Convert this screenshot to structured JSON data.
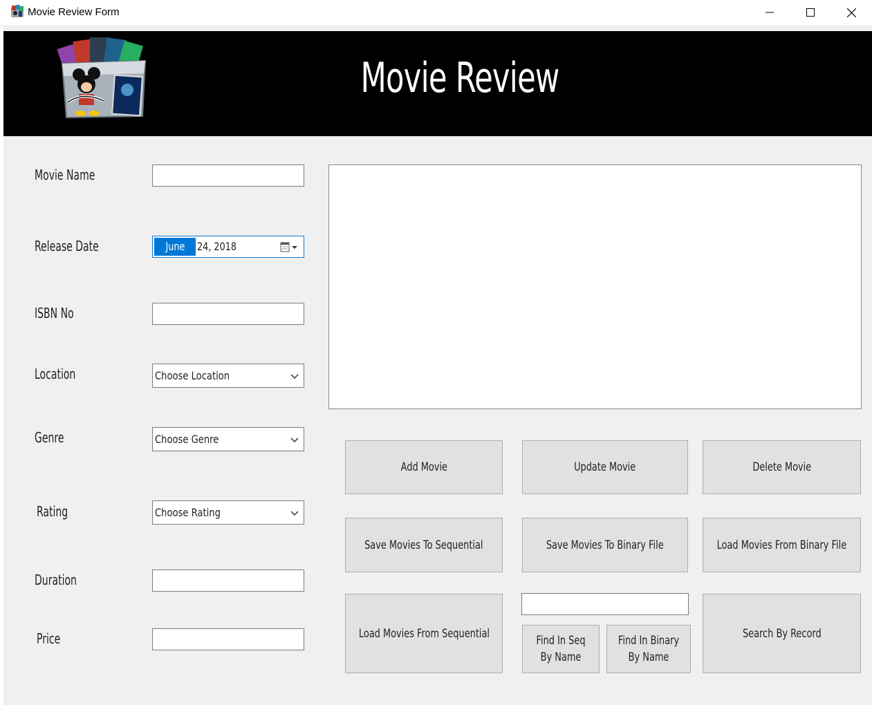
{
  "window": {
    "title": "Movie Review Form",
    "controls": {
      "minimize": "—",
      "maximize": "☐",
      "close": "✕"
    }
  },
  "header": {
    "title": "Movie Review",
    "logo_icon": "disney-movies-logo-icon",
    "background": "#000000"
  },
  "form": {
    "movie_name": {
      "label": "Movie Name",
      "value": ""
    },
    "release_date": {
      "label": "Release Date",
      "month": "June",
      "rest": "24,  2018"
    },
    "isbn": {
      "label": "ISBN No",
      "value": ""
    },
    "location": {
      "label": "Location",
      "selected": "Choose Location"
    },
    "genre": {
      "label": "Genre",
      "selected": "Choose Genre"
    },
    "rating": {
      "label": "Rating",
      "selected": "Choose Rating"
    },
    "duration": {
      "label": "Duration",
      "value": ""
    },
    "price": {
      "label": "Price",
      "value": ""
    }
  },
  "listbox": {
    "items": []
  },
  "buttons": {
    "add": "Add Movie",
    "update": "Update Movie",
    "delete": "Delete Movie",
    "save_sequential": "Save Movies To Sequential",
    "save_binary": "Save Movies To Binary File",
    "load_binary": "Load Movies From Binary File",
    "load_sequential": "Load Movies From Sequential",
    "find_seq": "Find In Seq By Name",
    "find_binary": "Find In Binary By Name",
    "search_record": "Search By Record"
  },
  "search": {
    "value": ""
  },
  "colors": {
    "accent": "#0078d7",
    "button_face": "#e1e1e1",
    "form_bg": "#f0f0f0"
  }
}
